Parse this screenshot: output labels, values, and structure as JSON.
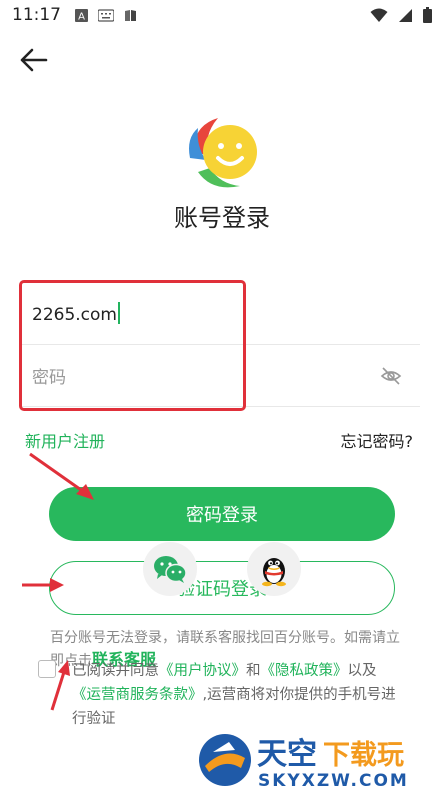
{
  "status_bar": {
    "time": "11:17"
  },
  "page": {
    "title": "账号登录"
  },
  "form": {
    "account_value": "2265.com",
    "password_placeholder": "密码"
  },
  "links": {
    "register": "新用户注册",
    "forgot": "忘记密码?"
  },
  "buttons": {
    "password_login": "密码登录",
    "code_login": "验证码登录"
  },
  "notice": {
    "text_before": "百分账号无法登录，请联系客服找回百分账号。如需请立即点击",
    "contact": "联系客服"
  },
  "agreement": {
    "prefix": "已阅读并同意",
    "user_agreement": "《用户协议》",
    "and": "和",
    "privacy": "《隐私政策》",
    "and2": "以及",
    "carrier_terms": "《运营商服务条款》",
    "suffix": ",运营商将对你提供的手机号进行验证"
  },
  "watermark": {
    "main": "天空下载玩",
    "sub": "SKYXZW.COM"
  },
  "colors": {
    "accent": "#28b85d",
    "highlight": "#e0303a"
  }
}
